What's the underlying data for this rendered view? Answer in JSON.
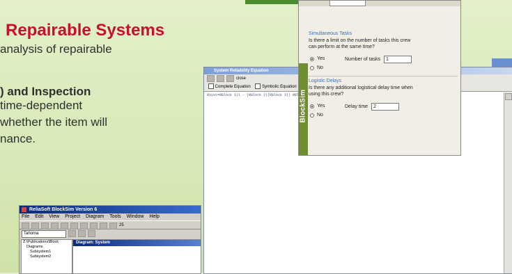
{
  "heading": "Repairable Systems",
  "paragraph1": [
    "analysis of repairable"
  ],
  "subheading": ") and Inspection",
  "paragraph2": [
    "time-dependent",
    "whether the item will",
    "nance."
  ],
  "app_window": {
    "title": "ReliaSoft BlockSim Version 6",
    "menu": [
      "File",
      "Edit",
      "View",
      "Project",
      "Diagram",
      "Tools",
      "Window",
      "Help"
    ],
    "font_name": "Tahoma",
    "zoom": "25",
    "tree_path": "Z:\\Publications\\Block",
    "tree_items": [
      "Diagrams",
      "Subsystem1",
      "Subsystem2"
    ],
    "diagram_title": "Diagram: System"
  },
  "equation_window": {
    "title": "System Reliability Equation",
    "close_label": "close",
    "option_complete": "Complete Equation",
    "option_symbolic": "Symbolic Equation",
    "equation_text": "RSyst=RBlock 1(1 - (RBlock 2)(RBlock 3)) RBlock 4 + RBlock 5 - RBlock 6 ..."
  },
  "dialog": {
    "group1_label": "Simultaneous Tasks",
    "group1_question": "Is there a limit on the number of tasks this crew can perform at the same time?",
    "group1_yes": "Yes",
    "group1_no": "No",
    "group1_yes_selected": true,
    "number_of_tasks_label": "Number of tasks",
    "number_of_tasks_value": "1",
    "group2_label": "Logistic Delays",
    "group2_question": "Is there any additional logistical delay time when using this crew?",
    "group2_yes": "Yes",
    "group2_no": "No",
    "group2_yes_selected": true,
    "delay_time_label": "Delay time",
    "delay_time_value": "2",
    "side_tab": "BlockSim"
  },
  "colors": {
    "heading": "#c8102e",
    "background": "#dcebc1",
    "blocksim_tab": "#6f8f2f",
    "group_label": "#3a6fc0"
  }
}
